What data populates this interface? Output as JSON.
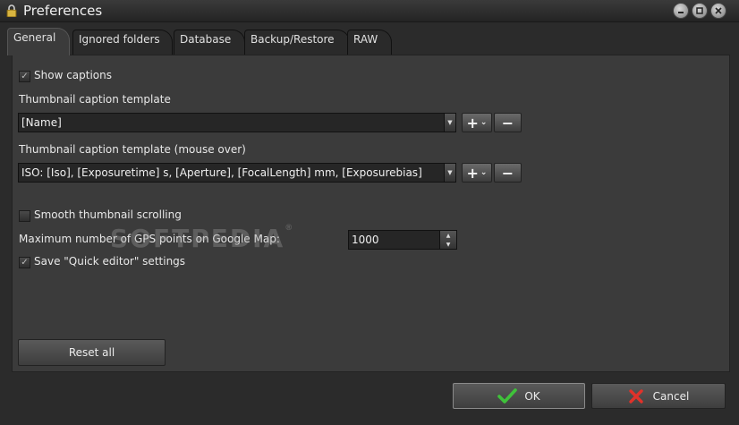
{
  "window": {
    "title": "Preferences"
  },
  "tabs": [
    {
      "label": "General"
    },
    {
      "label": "Ignored folders"
    },
    {
      "label": "Database"
    },
    {
      "label": "Backup/Restore"
    },
    {
      "label": "RAW"
    }
  ],
  "general": {
    "show_captions": {
      "label": "Show captions",
      "checked": true
    },
    "caption_template": {
      "label": "Thumbnail caption template",
      "value": "[Name]"
    },
    "caption_template_mouseover": {
      "label": "Thumbnail caption template (mouse over)",
      "value": "ISO: [Iso], [Exposuretime] s, [Aperture], [FocalLength] mm, [Exposurebias]"
    },
    "add_symbol": "+",
    "add_dropdown_symbol": "⌄",
    "remove_symbol": "−",
    "smooth_scrolling": {
      "label": "Smooth thumbnail scrolling",
      "checked": false
    },
    "gps_points": {
      "label": "Maximum number of GPS points on Google Map:",
      "value": "1000"
    },
    "quick_editor": {
      "label": "Save \"Quick editor\" settings",
      "checked": true
    },
    "reset_all": "Reset all"
  },
  "buttons": {
    "ok": "OK",
    "cancel": "Cancel"
  },
  "watermark": {
    "text": "SOFTPEDIA",
    "mark": "®"
  },
  "colors": {
    "ok_check": "#3fc23a",
    "cancel_x": "#e0322a"
  },
  "icons": {
    "lock": "lock-icon",
    "minimize": "minimize-icon",
    "maximize": "maximize-icon",
    "close": "close-icon",
    "ok": "checkmark-icon",
    "cancel": "x-icon"
  }
}
